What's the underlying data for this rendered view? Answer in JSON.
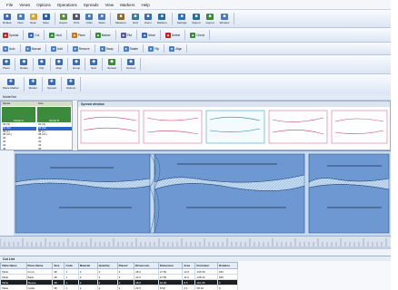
{
  "menu": [
    "File",
    "Views",
    "Options",
    "Operations",
    "Spreads",
    "View",
    "Markers",
    "Help"
  ],
  "toolbar1": [
    {
      "label": "Default",
      "icon": "file-icon",
      "color": "#3a6ab5"
    },
    {
      "label": "New",
      "icon": "new-file-icon",
      "color": "#4b7cc2"
    },
    {
      "label": "Open",
      "icon": "folder-icon",
      "color": "#d9a22e"
    },
    {
      "label": "Save",
      "icon": "save-icon",
      "color": "#2d5aa8"
    },
    {
      "label": "Export",
      "icon": "export-icon",
      "color": "#5b8c3a"
    },
    {
      "label": "Print",
      "icon": "print-icon",
      "color": "#556"
    },
    {
      "label": "Undo",
      "icon": "undo-icon",
      "color": "#4a78c0"
    },
    {
      "label": "Redo",
      "icon": "redo-icon",
      "color": "#4a78c0"
    },
    {
      "label": "Measure",
      "icon": "ruler-icon",
      "color": "#8a6a2a"
    },
    {
      "label": "Grid",
      "icon": "grid-icon",
      "color": "#3a7a9a"
    },
    {
      "label": "Zoom",
      "icon": "zoom-icon",
      "color": "#3a6ab5"
    },
    {
      "label": "Markers",
      "icon": "marker-icon",
      "color": "#2a6aa0"
    },
    {
      "label": "Settings",
      "icon": "gear-icon",
      "color": "#2d6ec0"
    },
    {
      "label": "Report",
      "icon": "report-icon",
      "color": "#2a6aa0"
    },
    {
      "label": "Layout",
      "icon": "layout-icon",
      "color": "#3a8a3a"
    },
    {
      "label": "Window",
      "icon": "window-icon",
      "color": "#4a78c0"
    }
  ],
  "toolbar2": [
    {
      "label": "Spread",
      "color": "#b03030"
    },
    {
      "label": "Cut",
      "color": "#3a6ab5"
    },
    {
      "label": "Nest",
      "color": "#3a8a3a"
    },
    {
      "label": "Piece",
      "color": "#c07a20"
    },
    {
      "label": "Marker",
      "color": "#3a8a3a"
    },
    {
      "label": "Plot",
      "color": "#5a5a9a"
    },
    {
      "label": "Move",
      "color": "#3a6ab5"
    },
    {
      "label": "Delete",
      "color": "#c02020"
    },
    {
      "label": "Check",
      "color": "#3a8a3a"
    }
  ],
  "toolbar3": [
    "Auto",
    "Manual",
    "Add",
    "Remove",
    "Swap",
    "Rotate",
    "Flip",
    "Align"
  ],
  "toolbar4": [
    {
      "label": "Place",
      "color": "#3a6ab5"
    },
    {
      "label": "Rotate",
      "color": "#3a6ab5"
    },
    {
      "label": "Flip",
      "color": "#3a6ab5"
    },
    {
      "label": "Align",
      "color": "#3a6ab5"
    },
    {
      "label": "Group",
      "color": "#3a6ab5"
    },
    {
      "label": "Nest",
      "color": "#3a6ab5"
    },
    {
      "label": "Spread",
      "color": "#3a8a3a"
    },
    {
      "label": "Options",
      "color": "#3a6ab5"
    }
  ],
  "toolbar5": [
    {
      "label": "Place Marker",
      "color": "#3a6ab5"
    },
    {
      "label": "Marker",
      "color": "#3a6ab5"
    },
    {
      "label": "Spread",
      "color": "#3a6ab5"
    },
    {
      "label": "Options",
      "color": "#3a6ab5"
    }
  ],
  "title_strip": "Model list",
  "model_panel": {
    "headers": [
      "Model",
      "Size"
    ],
    "thumb_labels": [
      "Model A",
      "Model B"
    ],
    "sizes_col1": [
      "32 (S)",
      "34 (M)",
      "36 (L)",
      "38 (XL)",
      "40",
      "42",
      "44",
      "46"
    ],
    "sizes_col2": [
      "32 (S)",
      "34 (M)",
      "36 (L)",
      "38 (XL)",
      "40",
      "42",
      "44",
      "46"
    ],
    "selected_index": 1
  },
  "spread_panel": {
    "title": "Spread window"
  },
  "cut_list": {
    "title": "Cut List",
    "columns": [
      "Table Name",
      "Piece Name",
      "Size",
      "Code",
      "Material",
      "Quantity",
      "Placed",
      "Dimension",
      "Dimension",
      "Area",
      "Perimeter",
      "Rotation"
    ],
    "rows": [
      [
        "Table",
        "Front",
        "38",
        "1",
        "2",
        "2",
        "2",
        "48.0",
        "27.50",
        "12.0",
        "136.59",
        "180"
      ],
      [
        "Table",
        "Back",
        "38",
        "1",
        "2",
        "2",
        "2",
        "42.5",
        "27.50",
        "11.0",
        "128.20",
        "180"
      ],
      [
        "Table",
        "Sleeve",
        "38",
        "1",
        "2",
        "2",
        "2",
        "38.0",
        "22.40",
        "8.5",
        "110.35",
        "0"
      ],
      [
        "Table",
        "Collar",
        "38",
        "1",
        "2",
        "2",
        "2",
        "22.5",
        "8.50",
        "2.1",
        "58.10",
        "0"
      ],
      [
        "Table",
        "Cuff",
        "38",
        "1",
        "2",
        "2",
        "2",
        "18.0",
        "6.20",
        "1.2",
        "44.60",
        "0"
      ]
    ],
    "selected_row": 2
  }
}
